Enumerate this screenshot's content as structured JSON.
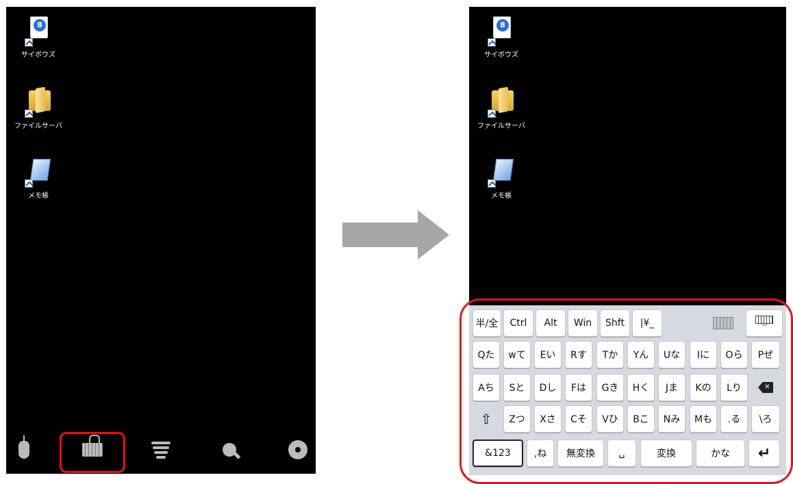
{
  "desktop": {
    "icons": [
      {
        "label": "サイボウズ",
        "icon": "cybozu-icon"
      },
      {
        "label": "ファイルサーバ",
        "icon": "folder-icon"
      },
      {
        "label": "メモ帳",
        "icon": "notepad-icon"
      }
    ]
  },
  "toolbar": {
    "buttons": [
      {
        "name": "mouse-icon"
      },
      {
        "name": "keyboard-icon",
        "highlighted": true
      },
      {
        "name": "menu-icon"
      },
      {
        "name": "magnifier-icon"
      },
      {
        "name": "settings-gear-icon"
      }
    ]
  },
  "keyboard": {
    "row1": [
      "半/全",
      "Ctrl",
      "Alt",
      "Win",
      "Shft",
      "|¥_"
    ],
    "row2": [
      "Qた",
      "wて",
      "Eい",
      "Rす",
      "Tか",
      "Yん",
      "Uな",
      "Iに",
      "Oら",
      "Pぜ"
    ],
    "row3": [
      "Aち",
      "Sと",
      "Dし",
      "Fは",
      "Gき",
      "Hく",
      "Jま",
      "Kの",
      "Lり"
    ],
    "row4": [
      "Zつ",
      "Xさ",
      "Cそ",
      "Vひ",
      "Bこ",
      "Nみ",
      "Mも",
      ".る",
      "\\ろ"
    ],
    "row5": {
      "num": "&123",
      "comma": ",ね",
      "muhenkan": "無変換",
      "space": "␣",
      "henkan": "変換",
      "kana": "かな",
      "enter": "↵"
    },
    "shift": "⇧"
  },
  "colors": {
    "highlight": "#e8101a",
    "arrow": "#a6a6a6"
  }
}
